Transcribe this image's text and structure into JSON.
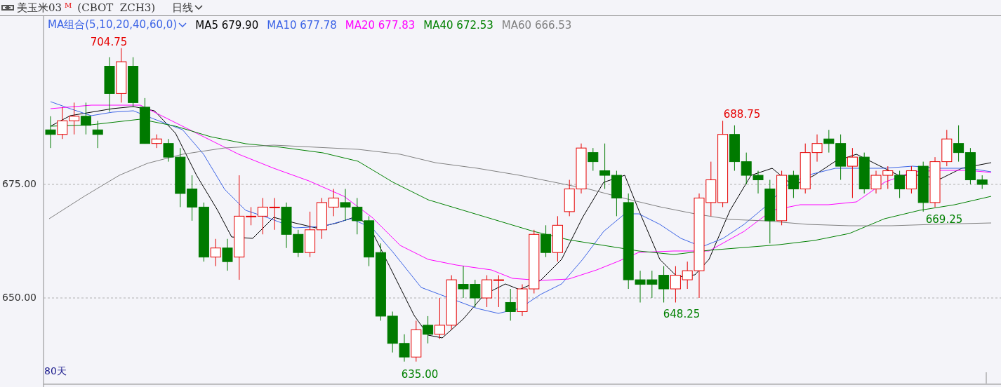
{
  "header": {
    "name": "美玉米03",
    "badge": "M",
    "code": "(CBOT  ZCH3)",
    "period": "日线"
  },
  "ma_selector": {
    "label": "MA组合(5,10,20,40,60,0)"
  },
  "ma_legend": [
    {
      "label": "MA5 679.90",
      "color": "#000000"
    },
    {
      "label": "MA10 677.78",
      "color": "#3c64e6"
    },
    {
      "label": "MA20 677.83",
      "color": "#ff00ff"
    },
    {
      "label": "MA40 672.53",
      "color": "#008000"
    },
    {
      "label": "MA60 666.53",
      "color": "#808080"
    }
  ],
  "y_axis": [
    "675.00",
    "650.00"
  ],
  "price_marks": [
    {
      "text": "704.75",
      "color": "#e60000"
    },
    {
      "text": "688.75",
      "color": "#e60000"
    },
    {
      "text": "648.25",
      "color": "#008000"
    },
    {
      "text": "669.25",
      "color": "#008000"
    },
    {
      "text": "635.00",
      "color": "#008000"
    }
  ],
  "range_label": "80天"
}
